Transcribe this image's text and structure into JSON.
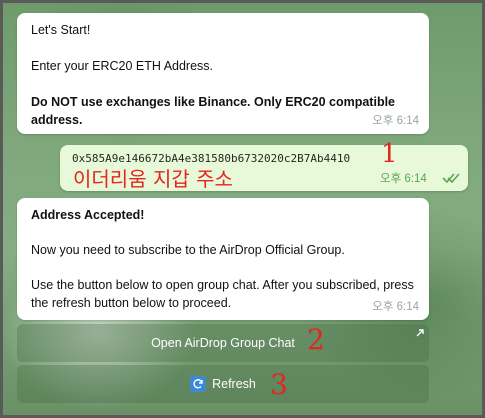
{
  "messages": {
    "m1": {
      "line1": "Let's Start!",
      "line2": "Enter your ERC20 ETH Address.",
      "line3": "Do NOT use exchanges like Binance. Only ERC20 compatible address.",
      "time": "오후 6:14"
    },
    "m2": {
      "text": "0x585A9e146672bA4e381580b6732020c2B7Ab4410",
      "time": "오후 6:14"
    },
    "m3": {
      "title": "Address Accepted!",
      "line2": "Now you need to subscribe to the AirDrop Official Group.",
      "line3": "Use the button below to open group chat. After you subscribed, press the refresh button below to proceed.",
      "time": "오후 6:14"
    }
  },
  "buttons": {
    "open_group": "Open AirDrop Group Chat",
    "refresh": "Refresh"
  },
  "annotations": {
    "n1": "1",
    "n2": "2",
    "n3": "3",
    "korean": "이더리움 지갑 주소"
  },
  "colors": {
    "annotation": "#e3261f",
    "outgoing_bubble": "#e8f9d9",
    "incoming_bubble": "#ffffff"
  },
  "icons": {
    "open_link": "arrow-up-right-icon",
    "refresh": "refresh-icon",
    "read_status": "double-check-icon"
  }
}
